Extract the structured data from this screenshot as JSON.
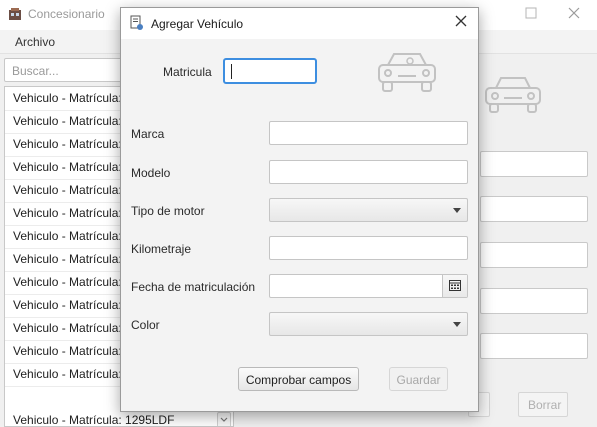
{
  "main_window": {
    "title": "Concesionario",
    "menu": {
      "archivo": "Archivo"
    },
    "search_placeholder": "Buscar...",
    "list_items": [
      "Vehiculo - Matrícula:",
      "Vehiculo - Matrícula:",
      "Vehiculo - Matrícula:",
      "Vehiculo - Matrícula:",
      "Vehiculo - Matrícula:",
      "Vehiculo - Matrícula:",
      "Vehiculo - Matrícula:",
      "Vehiculo - Matrícula:",
      "Vehiculo - Matrícula:",
      "Vehiculo - Matrícula:",
      "Vehiculo - Matrícula:",
      "Vehiculo - Matrícula:",
      "Vehiculo - Matrícula:",
      "Vehiculo - Matrícula: 1295LDF"
    ],
    "delete_button": "Borrar"
  },
  "dialog": {
    "title": "Agregar Vehículo",
    "labels": {
      "matricula": "Matricula",
      "marca": "Marca",
      "modelo": "Modelo",
      "tipo_motor": "Tipo de motor",
      "kilometraje": "Kilometraje",
      "fecha": "Fecha de matriculación",
      "color": "Color"
    },
    "values": {
      "matricula": "",
      "marca": "",
      "modelo": "",
      "tipo_motor": "",
      "kilometraje": "",
      "fecha": "",
      "color": ""
    },
    "buttons": {
      "check": "Comprobar campos",
      "save": "Guardar"
    }
  },
  "icons": {
    "app": "car-dealer-icon",
    "car": "car-icon",
    "calendar": "calendar-icon",
    "close": "close-icon"
  },
  "colors": {
    "focus": "#3d8ee0",
    "icon_gray": "#c2c2c2"
  }
}
